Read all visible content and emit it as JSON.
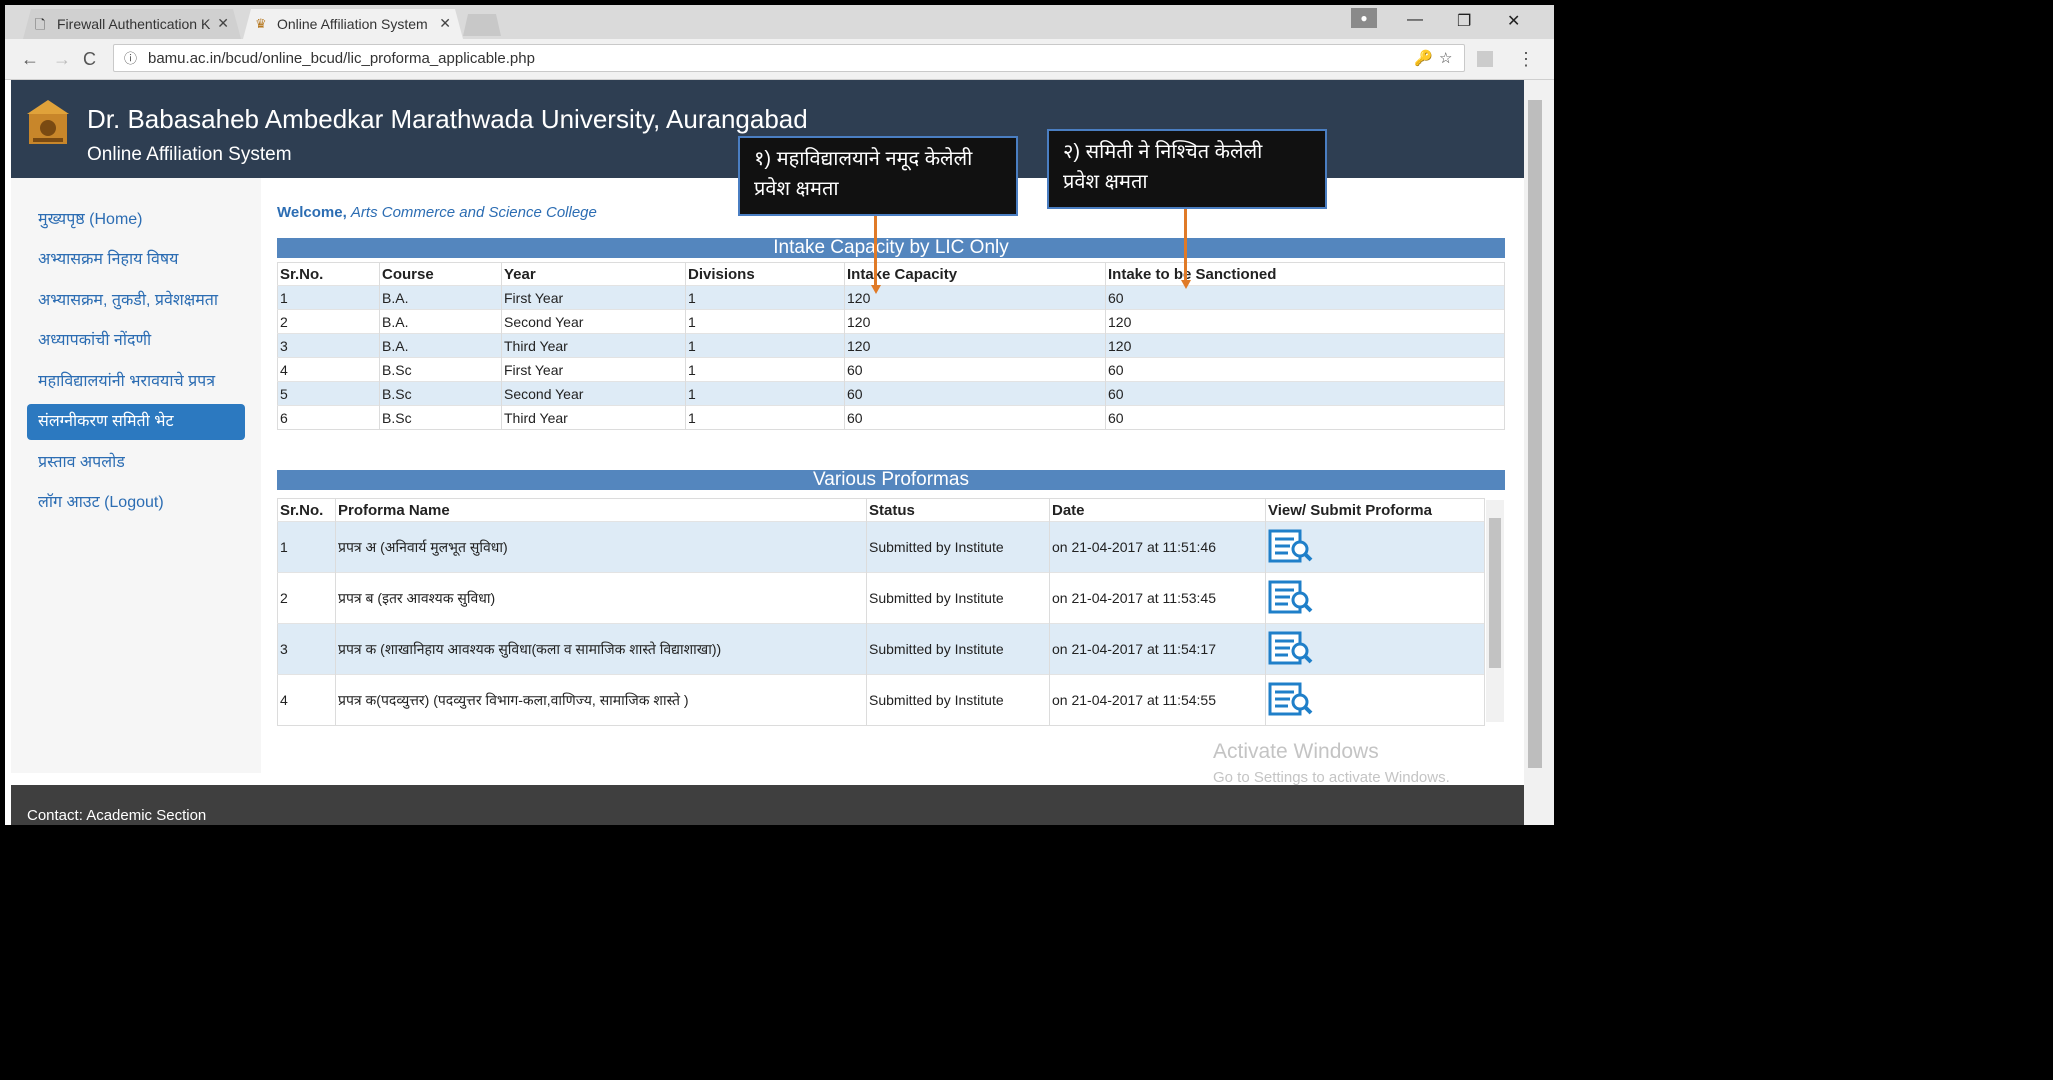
{
  "browser": {
    "tabs": [
      {
        "title": "Firewall Authentication K",
        "close": "✕"
      },
      {
        "title": "Online Affiliation System",
        "close": "✕"
      }
    ],
    "url": "bamu.ac.in/bcud/online_bcud/lic_proforma_applicable.php"
  },
  "header": {
    "university": "Dr. Babasaheb Ambedkar Marathwada University, Aurangabad",
    "system": "Online Affiliation System"
  },
  "sidebar": {
    "items": [
      {
        "label": "मुख्यपृष्ठ (Home)"
      },
      {
        "label": "अभ्यासक्रम निहाय विषय"
      },
      {
        "label": "अभ्यासक्रम, तुकडी, प्रवेशक्षमता"
      },
      {
        "label": "अध्यापकांची नोंदणी"
      },
      {
        "label": "महाविद्यालयांनी भरावयाचे प्रपत्र"
      },
      {
        "label": "संलग्नीकरण समिती भेट"
      },
      {
        "label": "प्रस्ताव अपलोड"
      },
      {
        "label": "लॉग आउट (Logout)"
      }
    ]
  },
  "welcome": {
    "prefix": "Welcome,",
    "college": "Arts Commerce and Science College"
  },
  "intake": {
    "title": "Intake Capacity by LIC Only",
    "columns": [
      "Sr.No.",
      "Course",
      "Year",
      "Divisions",
      "Intake Capacity",
      "Intake to be Sanctioned"
    ],
    "rows": [
      [
        "1",
        "B.A.",
        "First Year",
        "1",
        "120",
        "60"
      ],
      [
        "2",
        "B.A.",
        "Second Year",
        "1",
        "120",
        "120"
      ],
      [
        "3",
        "B.A.",
        "Third Year",
        "1",
        "120",
        "120"
      ],
      [
        "4",
        "B.Sc",
        "First Year",
        "1",
        "60",
        "60"
      ],
      [
        "5",
        "B.Sc",
        "Second Year",
        "1",
        "60",
        "60"
      ],
      [
        "6",
        "B.Sc",
        "Third Year",
        "1",
        "60",
        "60"
      ]
    ]
  },
  "proformas": {
    "title": "Various Proformas",
    "columns": [
      "Sr.No.",
      "Proforma Name",
      "Status",
      "Date",
      "View/ Submit Proforma"
    ],
    "rows": [
      [
        "1",
        "प्रपत्र अ (अनिवार्य मुलभूत सुविधा)",
        "Submitted by Institute",
        "on 21-04-2017 at 11:51:46"
      ],
      [
        "2",
        "प्रपत्र ब (इतर आवश्यक सुविधा)",
        "Submitted by Institute",
        "on 21-04-2017 at 11:53:45"
      ],
      [
        "3",
        "प्रपत्र क (शाखानिहाय आवश्यक सुविधा(कला व सामाजिक शास्ते विद्याशाखा))",
        "Submitted by Institute",
        "on 21-04-2017 at 11:54:17"
      ],
      [
        "4",
        "प्रपत्र क(पदव्युत्तर) (पदव्युत्तर विभाग-कला,वाणिज्य, सामाजिक शास्ते )",
        "Submitted by Institute",
        "on 21-04-2017 at 11:54:55"
      ]
    ]
  },
  "callouts": {
    "left": {
      "line1": "१) महाविद्यालयाने नमूद केलेली",
      "line2": "प्रवेश क्षमता"
    },
    "right": {
      "line1": "२) समिती ने निश्चित केलेली",
      "line2": "प्रवेश क्षमता"
    }
  },
  "footer": {
    "contact": "Contact: Academic Section"
  },
  "watermark": {
    "line1": "Activate Windows",
    "line2": "Go to Settings to activate Windows."
  },
  "colors": {
    "header": "#2e3e52",
    "accent": "#2c79c0",
    "bar": "#5486be",
    "row_alt": "#deebf6",
    "arrow": "#e07a27"
  }
}
